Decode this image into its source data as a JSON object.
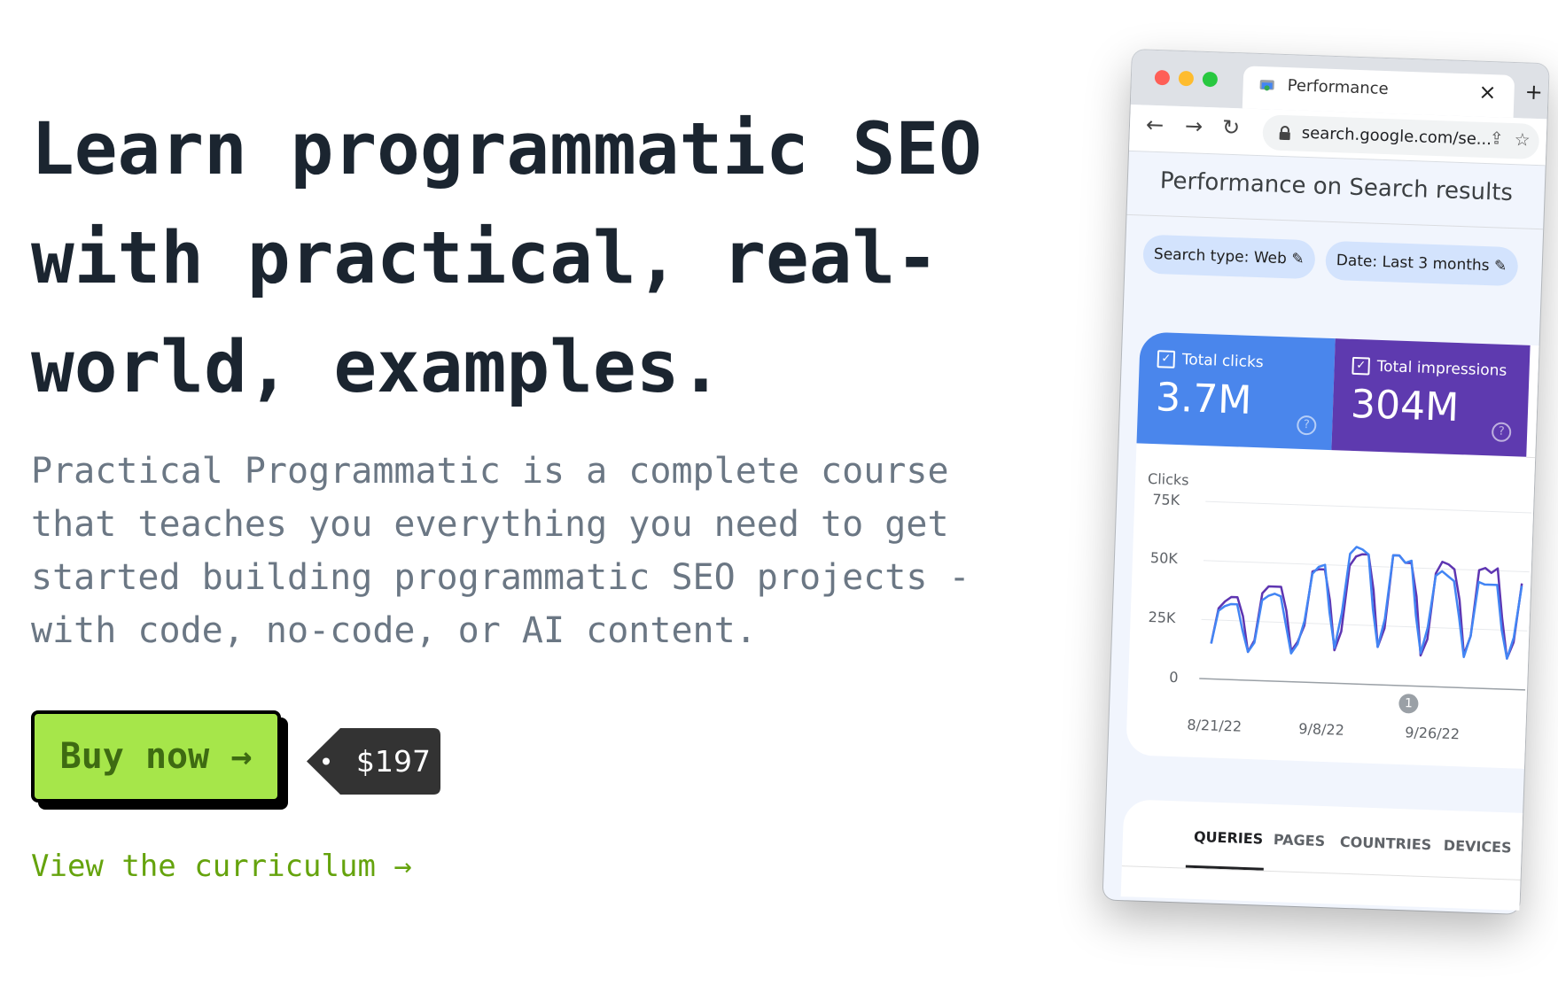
{
  "hero": {
    "title_lines": [
      "Learn programmatic SEO",
      "with practical, real-",
      "world, examples."
    ],
    "description_lines": [
      "Practical Programmatic is a complete course",
      "that teaches you everything you need to get",
      "started building programmatic SEO projects -",
      "with code, no-code, or AI content."
    ],
    "buy_label": "Buy now →",
    "price": "$197",
    "curriculum_link": "View the curriculum →",
    "colors": {
      "accent_green": "#a6e64a",
      "link_green": "#65a30d",
      "text_dark": "#1b2530"
    }
  },
  "browser": {
    "tab_title": "Performance",
    "tab_icon": "search-console-icon",
    "url": "search.google.com/se...",
    "page_title": "Performance on Search results",
    "chips": [
      "Search type: Web",
      "Date: Last 3 months"
    ],
    "metrics": [
      {
        "label": "Total clicks",
        "value": "3.7M",
        "color": "#4a86ec"
      },
      {
        "label": "Total impressions",
        "value": "304M",
        "color": "#5e3aaf"
      }
    ],
    "chart_label": "Clicks",
    "annotation": "1",
    "report_tabs": [
      "QUERIES",
      "PAGES",
      "COUNTRIES",
      "DEVICES"
    ]
  },
  "chart_data": {
    "type": "line",
    "ylabel": "Clicks",
    "yticks": [
      "75K",
      "50K",
      "25K",
      "0"
    ],
    "ylim": [
      0,
      75000
    ],
    "xticks": [
      "8/21/22",
      "9/8/22",
      "9/26/22"
    ],
    "x_start": "8/21/22",
    "grid": true,
    "series": [
      {
        "color": "#4285f4",
        "values": [
          15,
          29,
          31,
          32,
          32,
          21,
          12,
          16,
          34,
          36,
          37,
          36,
          24,
          12,
          16,
          26,
          46,
          49,
          50,
          30,
          15,
          30,
          55,
          58,
          57,
          55,
          32,
          16,
          28,
          55,
          55,
          52,
          53,
          30,
          14,
          25,
          47,
          49,
          47,
          45,
          30,
          13,
          22,
          45,
          44,
          44,
          44,
          25,
          13,
          22,
          44
        ]
      },
      {
        "color": "#5e35b1",
        "values": [
          15,
          30,
          33,
          35,
          35,
          27,
          12,
          17,
          37,
          40,
          40,
          40,
          30,
          13,
          17,
          24,
          47,
          48,
          48,
          35,
          14,
          22,
          50,
          54,
          55,
          55,
          40,
          16,
          24,
          55,
          55,
          52,
          52,
          38,
          13,
          20,
          48,
          53,
          52,
          50,
          37,
          14,
          22,
          50,
          51,
          49,
          51,
          30,
          13,
          20,
          45
        ]
      }
    ]
  }
}
